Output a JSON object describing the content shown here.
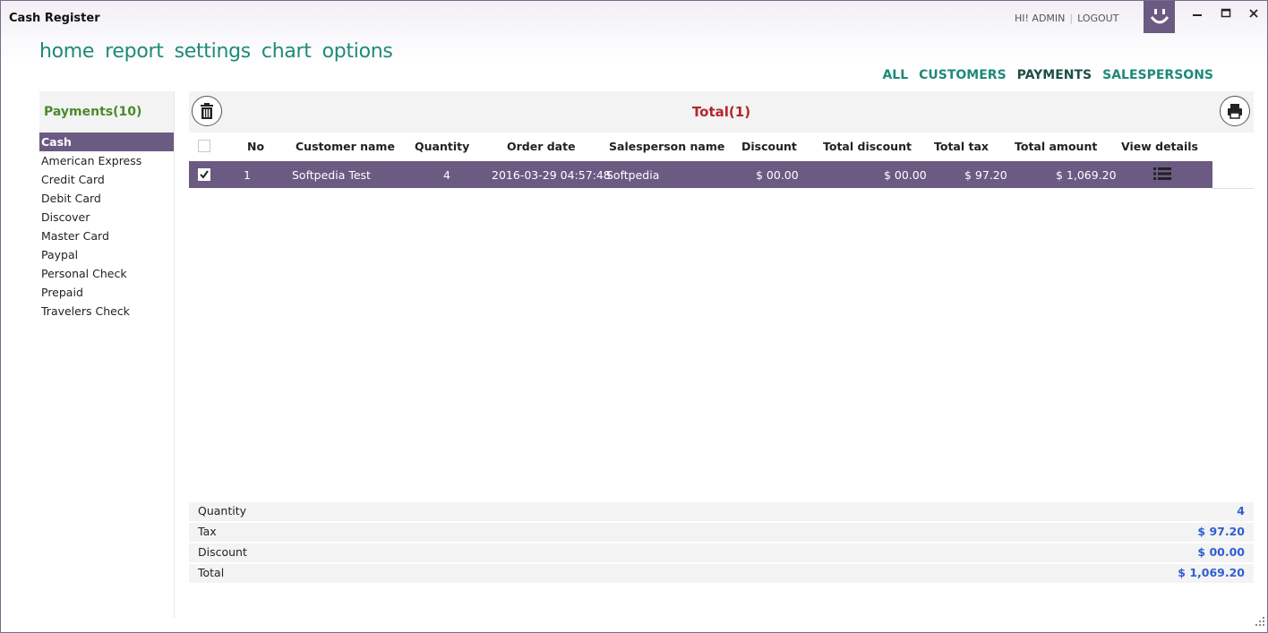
{
  "app": {
    "title": "Cash Register"
  },
  "user": {
    "greeting": "HI! ADMIN",
    "separator": "|",
    "logout": "LOGOUT"
  },
  "icons": {
    "app_badge": "smiley-icon",
    "minimize": "minimize-icon",
    "maximize": "maximize-icon",
    "close": "close-icon",
    "delete": "trash-icon",
    "print": "printer-icon",
    "details": "list-icon"
  },
  "colors": {
    "accent": "#6b5a82",
    "nav": "#1e8a78",
    "total_title": "#b3262b",
    "summary_values": "#2f5fd0",
    "payments_header": "#4c8a2e"
  },
  "nav": {
    "items": [
      "home",
      "report",
      "settings",
      "chart",
      "options"
    ]
  },
  "filters": {
    "all": "ALL",
    "customers": "CUSTOMERS",
    "payments": "PAYMENTS",
    "salespersons": "SALESPERSONS",
    "active": "PAYMENTS"
  },
  "sidebar": {
    "title": "Payments(10)",
    "items": [
      "Cash",
      "American Express",
      "Credit Card",
      "Debit Card",
      "Discover",
      "Master Card",
      "Paypal",
      "Personal Check",
      "Prepaid",
      "Travelers Check"
    ],
    "selected": "Cash"
  },
  "main": {
    "title": "Total(1)"
  },
  "table": {
    "columns": [
      "No",
      "Customer name",
      "Quantity",
      "Order date",
      "Salesperson name",
      "Discount",
      "Total discount",
      "Total tax",
      "Total amount",
      "View details"
    ],
    "rows": [
      {
        "checked": true,
        "no": "1",
        "customer": "Softpedia Test",
        "quantity": "4",
        "order_date": "2016-03-29 04:57:48",
        "salesperson": "Softpedia",
        "discount": "$ 00.00",
        "total_discount": "$ 00.00",
        "total_tax": "$ 97.20",
        "total_amount": "$ 1,069.20"
      }
    ]
  },
  "summary": [
    {
      "label": "Quantity",
      "value": "4"
    },
    {
      "label": "Tax",
      "value": "$ 97.20"
    },
    {
      "label": "Discount",
      "value": "$ 00.00"
    },
    {
      "label": "Total",
      "value": "$ 1,069.20"
    }
  ]
}
